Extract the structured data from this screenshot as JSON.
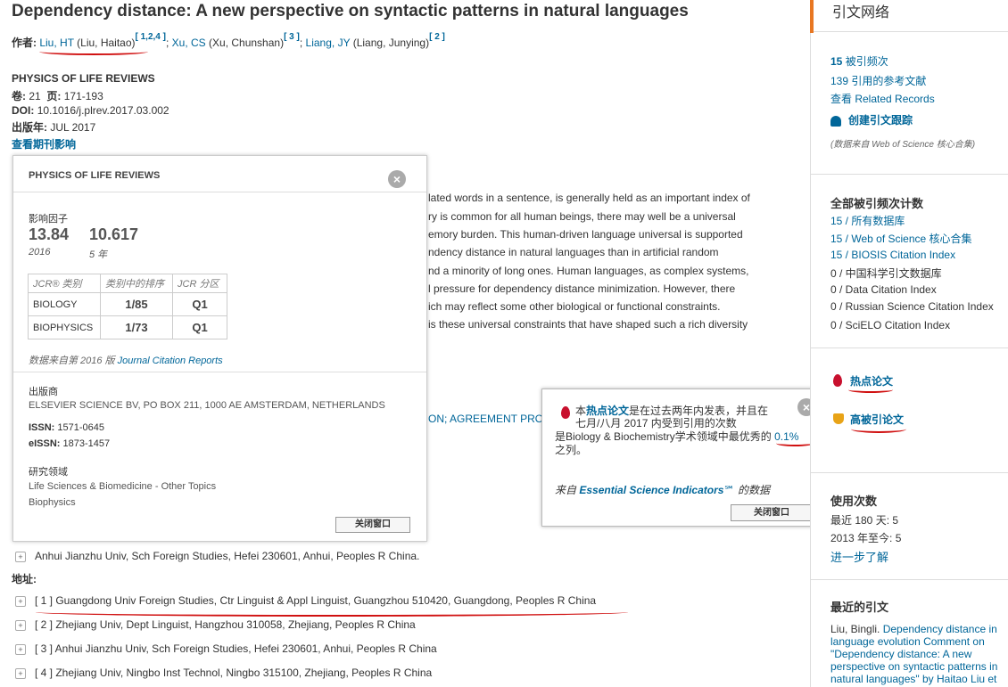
{
  "article": {
    "title": "Dependency distance: A new perspective on syntactic patterns in natural languages",
    "authors_label": "作者:",
    "authors": [
      {
        "short": "Liu, HT",
        "full": " (Liu, Haitao)",
        "refs": "[ 1,2,4 ]",
        "sep": ";"
      },
      {
        "short": "Xu, CS",
        "full": " (Xu, Chunshan)",
        "refs": "[ 3 ]",
        "sep": ";"
      },
      {
        "short": "Liang, JY",
        "full": " (Liang, Junying)",
        "refs": "[ 2 ]",
        "sep": ""
      }
    ],
    "journal": "PHYSICS OF LIFE REVIEWS",
    "volume_label": "卷:",
    "volume": "21",
    "pages_label": "页:",
    "pages": "171-193",
    "doi_label": "DOI:",
    "doi": "10.1016/j.plrev.2017.03.002",
    "pubyear_label": "出版年:",
    "pubyear": "JUL 2017",
    "impact_link": "查看期刊影响"
  },
  "abstract_lines": [
    "lated words in a sentence, is generally held as an important index of",
    "ry is common for all human beings, there may well be a universal",
    "emory burden. This human-driven language universal is supported",
    "ndency distance in natural languages than in artificial random",
    "nd a minority of long ones. Human languages, as complex systems,",
    "l pressure for dependency distance minimization. However, there",
    "ich may reflect some other biological or functional constraints.",
    "is these universal constraints that have shaped such a rich diversity"
  ],
  "keywords_fragment": "ON; AGREEMENT PROC",
  "journal_popup": {
    "title": "PHYSICS OF LIFE REVIEWS",
    "if_label": "影响因子",
    "if_2016": "13.84",
    "if_2016_label": "2016",
    "if_5yr": "10.617",
    "if_5yr_label": "5 年",
    "table_headers": [
      "JCR® 类别",
      "类别中的排序",
      "JCR 分区"
    ],
    "table_rows": [
      {
        "cat": "BIOLOGY",
        "rank": "1/85",
        "q": "Q1"
      },
      {
        "cat": "BIOPHYSICS",
        "rank": "1/73",
        "q": "Q1"
      }
    ],
    "source_prefix": "数据来自第 2016 版 ",
    "source_link": "Journal Citation Reports",
    "publisher_label": "出版商",
    "publisher": "ELSEVIER SCIENCE BV, PO BOX 211, 1000 AE AMSTERDAM, NETHERLANDS",
    "issn_label": "ISSN:",
    "issn": "1571-0645",
    "eissn_label": "eISSN:",
    "eissn": "1873-1457",
    "area_label": "研究领域",
    "areas": [
      "Life Sciences & Biomedicine - Other Topics",
      "Biophysics"
    ],
    "close_button": "关闭窗口"
  },
  "hot_popup": {
    "line1_a": "本",
    "line1_b": "热点论文",
    "line1_c": "是在过去两年内发表，并且在",
    "line2": "七月/八月 2017 内受到引用的次数",
    "line3_a": "是Biology & Biochemistry学术领域中最优秀的 ",
    "line3_b": "0.1%",
    "line4": "之列。",
    "source_a": "来自 ",
    "source_b": "Essential Science Indicators℠",
    "source_c": " 的数据",
    "close_button": "关闭窗口"
  },
  "address": {
    "partial_row": "Anhui Jianzhu Univ, Sch Foreign Studies, Hefei 230601, Anhui, Peoples R China.",
    "label": "地址:",
    "rows": [
      "[ 1 ] Guangdong Univ Foreign Studies, Ctr Linguist & Appl Linguist, Guangzhou 510420, Guangdong, Peoples R China",
      "[ 2 ] Zhejiang Univ, Dept Linguist, Hangzhou 310058, Zhejiang, Peoples R China",
      "[ 3 ] Anhui Jianzhu Univ, Sch Foreign Studies, Hefei 230601, Anhui, Peoples R China",
      "[ 4 ] Zhejiang Univ, Ningbo Inst Technol, Ningbo 315100, Zhejiang, Peoples R China"
    ]
  },
  "sidebar": {
    "heading": "引文网络",
    "times_cited_num": "15",
    "times_cited_label": " 被引频次",
    "refs": "139 引用的参考文献",
    "related": "查看 Related Records",
    "alert": "创建引文跟踪",
    "source_note": "(数据来自 Web of Science 核心合集)",
    "all_counts_title": "全部被引频次计数",
    "counts": [
      {
        "text": "15 / 所有数据库",
        "link": true
      },
      {
        "text": "15 / Web of Science 核心合集",
        "link": true
      },
      {
        "text": "15 / BIOSIS Citation Index",
        "link": true
      },
      {
        "text": "0 / 中国科学引文数据库",
        "link": false
      },
      {
        "text": "0 / Data Citation Index",
        "link": false
      },
      {
        "text": "0 / Russian Science Citation Index",
        "link": false
      },
      {
        "text": "0 / SciELO Citation Index",
        "link": false
      }
    ],
    "hot_paper": "热点论文",
    "highly_cited": "高被引论文",
    "usage_title": "使用次数",
    "usage_180": "最近 180 天: 5",
    "usage_2013": "2013 年至今: 5",
    "learn_more": "进一步了解",
    "recent_title": "最近的引文",
    "recent_author": "Liu, Bingli. ",
    "recent_lines": [
      "Dependency distance in",
      "language evolution Comment on",
      "\"Dependency distance: A new",
      "perspective on syntactic patterns in",
      "natural languages\" by Haitao Liu et"
    ]
  },
  "colors": {
    "link": "#006699",
    "accent": "#e87722",
    "annotation_red": "#d01010",
    "flame": "#c8102e"
  }
}
